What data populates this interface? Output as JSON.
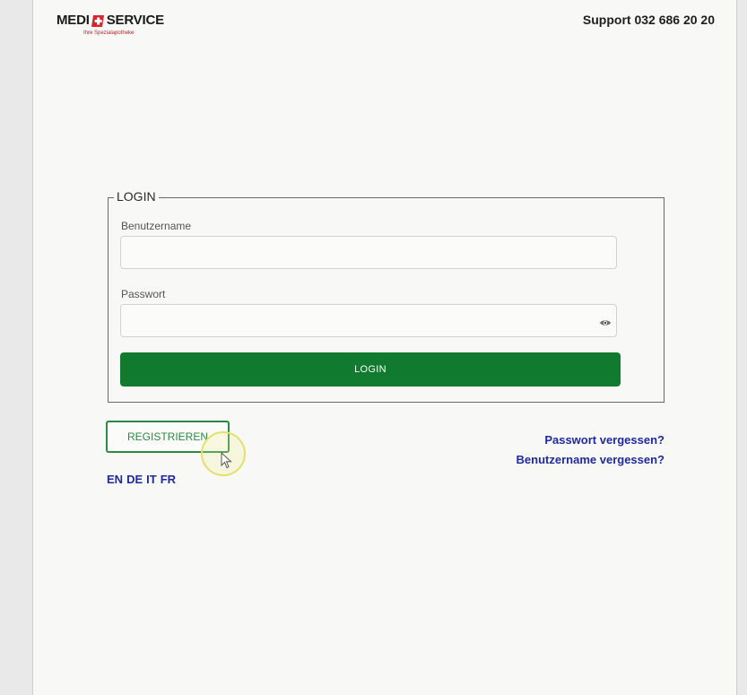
{
  "header": {
    "logo_left": "MEDI",
    "logo_right": "SERVICE",
    "logo_tagline": "Ihre Spezialapotheke",
    "support_text": "Support 032 686 20 20"
  },
  "login_form": {
    "legend": "LOGIN",
    "username_label": "Benutzername",
    "username_value": "",
    "password_label": "Passwort",
    "password_value": "",
    "login_button": "LOGIN"
  },
  "actions": {
    "register_button": "REGISTRIEREN",
    "forgot_password": "Passwort vergessen?",
    "forgot_username": "Benutzername vergessen?"
  },
  "languages": [
    "EN",
    "DE",
    "IT",
    "FR"
  ],
  "colors": {
    "primary_green": "#107a2e",
    "link_blue": "#1f2aa0",
    "brand_red": "#d7262c"
  },
  "icons": {
    "password_toggle": "eye-icon",
    "logo_mark": "swiss-cross-icon"
  }
}
